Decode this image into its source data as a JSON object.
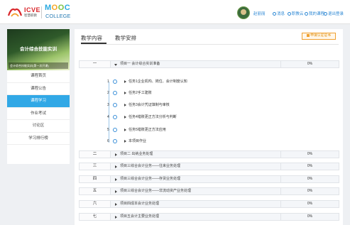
{
  "header": {
    "brand_icve": "ICVE",
    "brand_icve_sub": "智慧职教",
    "brand_mooc_letters": [
      "M",
      "O",
      "O",
      "C"
    ],
    "brand_college": "COLLEGE",
    "user_name": "赵丽丽",
    "links": [
      "消息",
      "职教云",
      "我的课程",
      "退出登录"
    ],
    "colors": {
      "accent": "#31a8e6",
      "brand_red": "#d9252a"
    }
  },
  "sidebar": {
    "banner_title": "会计综合技能实训",
    "banner_subtitle": "会计综合技能实训(第一次开课)",
    "items": [
      {
        "label": "课程首页",
        "active": false
      },
      {
        "label": "课程公告",
        "active": false
      },
      {
        "label": "课程学习",
        "active": true
      },
      {
        "label": "作业考试",
        "active": false
      },
      {
        "label": "讨论区",
        "active": false
      },
      {
        "label": "学习排行榜",
        "active": false
      }
    ]
  },
  "main": {
    "tabs": [
      "教学内容",
      "教学安排"
    ],
    "cert_button": "申请认证证书",
    "projects": [
      {
        "num": "一",
        "title": "项目一 会计综合实训准备",
        "percent": "0%",
        "expanded": true
      },
      {
        "num": "二",
        "title": "项目二 出纳业务处理",
        "percent": "0%",
        "expanded": false
      },
      {
        "num": "三",
        "title": "项目三综合会计业务——往来业务处理",
        "percent": "0%",
        "expanded": false
      },
      {
        "num": "四",
        "title": "项目三综合会计业务——存货业务处理",
        "percent": "0%",
        "expanded": false
      },
      {
        "num": "五",
        "title": "项目三综合会计业务——非流动资产业务处理",
        "percent": "0%",
        "expanded": false
      },
      {
        "num": "六",
        "title": "项目四成本会计业务处理",
        "percent": "0%",
        "expanded": false
      },
      {
        "num": "七",
        "title": "项目五会计主要业务处理",
        "percent": "0%",
        "expanded": false
      }
    ],
    "tasks": [
      {
        "num": "1",
        "title": "任务1企业机构、岗位、会计制度认知"
      },
      {
        "num": "2",
        "title": "任务2手工建账"
      },
      {
        "num": "3",
        "title": "任务3会计凭证填制与审核"
      },
      {
        "num": "4",
        "title": "任务4错账更正方法分析与判断"
      },
      {
        "num": "5",
        "title": "任务5错账更正方法应用"
      },
      {
        "num": "6",
        "title": "本项目作业"
      }
    ]
  }
}
